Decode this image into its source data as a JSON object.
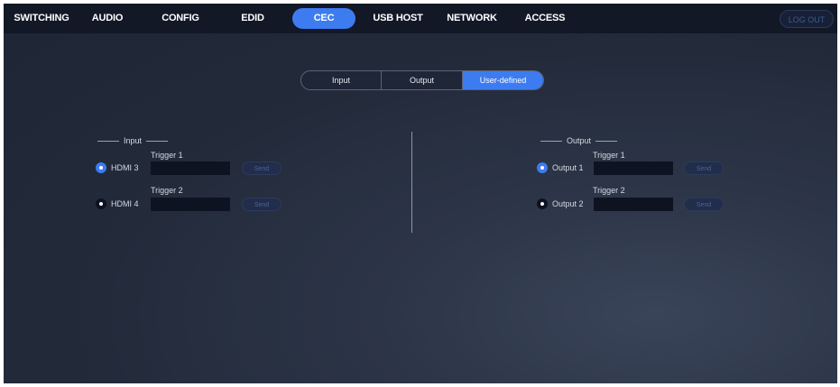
{
  "nav": {
    "items": [
      {
        "label": "SWITCHING"
      },
      {
        "label": "AUDIO"
      },
      {
        "label": "CONFIG"
      },
      {
        "label": "EDID"
      },
      {
        "label": "CEC",
        "active": true
      },
      {
        "label": "USB HOST"
      },
      {
        "label": "NETWORK"
      },
      {
        "label": "ACCESS"
      }
    ],
    "logout_label": "LOG OUT"
  },
  "tabs": [
    {
      "label": "Input"
    },
    {
      "label": "Output"
    },
    {
      "label": "User-defined",
      "active": true
    }
  ],
  "input_group": {
    "title": "Input",
    "rows": [
      {
        "port": "HDMI 3",
        "selected": true,
        "trigger_label": "Trigger 1",
        "value": "",
        "send_label": "Send"
      },
      {
        "port": "HDMI 4",
        "selected": false,
        "trigger_label": "Trigger 2",
        "value": "",
        "send_label": "Send"
      }
    ]
  },
  "output_group": {
    "title": "Output",
    "rows": [
      {
        "port": "Output 1",
        "selected": true,
        "trigger_label": "Trigger 1",
        "value": "",
        "send_label": "Send"
      },
      {
        "port": "Output 2",
        "selected": false,
        "trigger_label": "Trigger 2",
        "value": "",
        "send_label": "Send"
      }
    ]
  },
  "colors": {
    "accent": "#3d7cf0",
    "nav_bg": "#121826",
    "page_bg": "#232b3b"
  }
}
